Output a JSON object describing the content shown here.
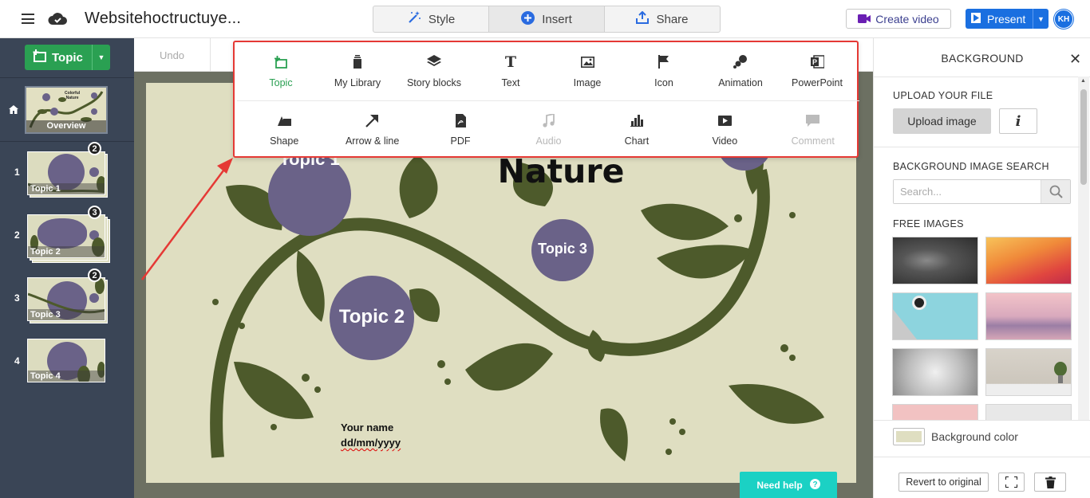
{
  "header": {
    "title": "Websitehoctructuye...",
    "tabs": [
      {
        "label": "Style",
        "icon": "magic-wand-icon"
      },
      {
        "label": "Insert",
        "icon": "plus-circle-icon"
      },
      {
        "label": "Share",
        "icon": "share-upload-icon"
      }
    ],
    "create_video_label": "Create video",
    "present_label": "Present",
    "avatar_initials": "KH",
    "colors": {
      "present": "#1a6fe0",
      "create_video_icon": "#6a1fb3"
    }
  },
  "sidebar": {
    "topic_button_label": "Topic",
    "overview": {
      "label": "Overview",
      "title_line1": "Colorful",
      "title_line2": "Nature"
    },
    "slides": [
      {
        "number": "1",
        "label": "Topic 1",
        "badge": "2"
      },
      {
        "number": "2",
        "label": "Topic 2",
        "badge": "3"
      },
      {
        "number": "3",
        "label": "Topic 3",
        "badge": "2"
      },
      {
        "number": "4",
        "label": "Topic 4",
        "badge": ""
      }
    ],
    "colors": {
      "background": "#3a4556",
      "topic_button": "#2aa052"
    }
  },
  "toolbar": {
    "undo_label": "Undo"
  },
  "insert_menu": {
    "row1": [
      {
        "label": "Topic",
        "icon": "topic-add-icon",
        "selected": true
      },
      {
        "label": "My Library",
        "icon": "library-icon"
      },
      {
        "label": "Story blocks",
        "icon": "layers-icon"
      },
      {
        "label": "Text",
        "icon": "text-icon"
      },
      {
        "label": "Image",
        "icon": "image-icon"
      },
      {
        "label": "Icon",
        "icon": "flag-icon"
      },
      {
        "label": "Animation",
        "icon": "animation-icon"
      },
      {
        "label": "PowerPoint",
        "icon": "powerpoint-icon"
      }
    ],
    "row2": [
      {
        "label": "Shape",
        "icon": "shape-icon"
      },
      {
        "label": "Arrow & line",
        "icon": "arrow-icon"
      },
      {
        "label": "PDF",
        "icon": "pdf-icon"
      },
      {
        "label": "Audio",
        "icon": "music-note-icon",
        "disabled": true
      },
      {
        "label": "Chart",
        "icon": "bar-chart-icon"
      },
      {
        "label": "Video",
        "icon": "video-icon"
      },
      {
        "label": "Comment",
        "icon": "comment-icon",
        "disabled": true
      }
    ],
    "colors": {
      "highlight_border": "#e53935",
      "selected": "#2aa052"
    }
  },
  "slide": {
    "title": "Nature",
    "topic1": "Topic 1",
    "topic2": "Topic 2",
    "topic3": "Topic 3",
    "author": "Your name",
    "date": "dd/mm/yyyy",
    "colors": {
      "background": "#dfdec1",
      "leaf": "#4d5a2b",
      "topic": "#6a6288"
    }
  },
  "help": {
    "label": "Need help",
    "icon": "help-circle-icon",
    "color": "#1bd1c4"
  },
  "right_panel": {
    "title": "BACKGROUND",
    "upload_section": "UPLOAD YOUR FILE",
    "upload_button": "Upload image",
    "info_button": "i",
    "search_section": "BACKGROUND IMAGE SEARCH",
    "search_placeholder": "Search...",
    "free_images_section": "FREE IMAGES",
    "background_color_label": "Background color",
    "revert_label": "Revert to original"
  }
}
